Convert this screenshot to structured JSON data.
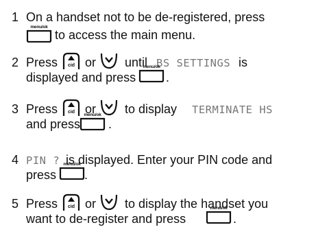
{
  "menu_key_label": "menu/ok",
  "cid_key_label": "cid",
  "steps": [
    {
      "num": "1",
      "l1": "On a handset not to be de-registered, press",
      "l2": "to access the main menu."
    },
    {
      "num": "2",
      "press": "Press",
      "or": "or",
      "until": "until",
      "lcd": "BS SETTINGS",
      "is": "is",
      "l2": "displayed and press",
      "end": "."
    },
    {
      "num": "3",
      "press": "Press",
      "or": "or",
      "todisplay": "to display",
      "lcd": "TERMINATE HS",
      "l2": "and press",
      "end": "."
    },
    {
      "num": "4",
      "lcd": "PIN ?",
      "rest": "is displayed. Enter your PIN code and",
      "l2": "press",
      "end": "."
    },
    {
      "num": "5",
      "press": "Press",
      "or": "or",
      "rest": "to display the handset you",
      "l2": "want to de-register and press",
      "end": "."
    }
  ]
}
